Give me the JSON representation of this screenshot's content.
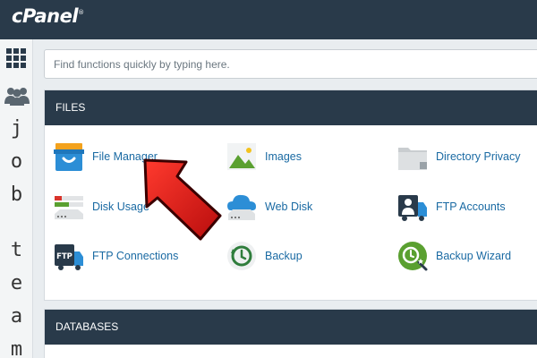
{
  "header": {
    "logo_text": "cPanel",
    "logo_mark": "®"
  },
  "leftbar": {
    "letters_top": [
      "j",
      "o",
      "b"
    ],
    "letters_bottom": [
      "t",
      "e",
      "a",
      "m"
    ]
  },
  "search": {
    "placeholder": "Find functions quickly by typing here."
  },
  "files": {
    "title": "FILES",
    "items": [
      {
        "label": "File Manager",
        "icon": "file-manager-icon"
      },
      {
        "label": "Images",
        "icon": "images-icon"
      },
      {
        "label": "Directory Privacy",
        "icon": "directory-privacy-icon"
      },
      {
        "label": "Disk Usage",
        "icon": "disk-usage-icon"
      },
      {
        "label": "Web Disk",
        "icon": "web-disk-icon"
      },
      {
        "label": "FTP Accounts",
        "icon": "ftp-accounts-icon"
      },
      {
        "label": "FTP Connections",
        "icon": "ftp-connections-icon",
        "badge": "FTP"
      },
      {
        "label": "Backup",
        "icon": "backup-icon"
      },
      {
        "label": "Backup Wizard",
        "icon": "backup-wizard-icon"
      }
    ]
  },
  "databases": {
    "title": "DATABASES"
  },
  "colors": {
    "topbar": "#293a4a",
    "link": "#1a6aa3",
    "annotation_arrow": "#d21414"
  }
}
